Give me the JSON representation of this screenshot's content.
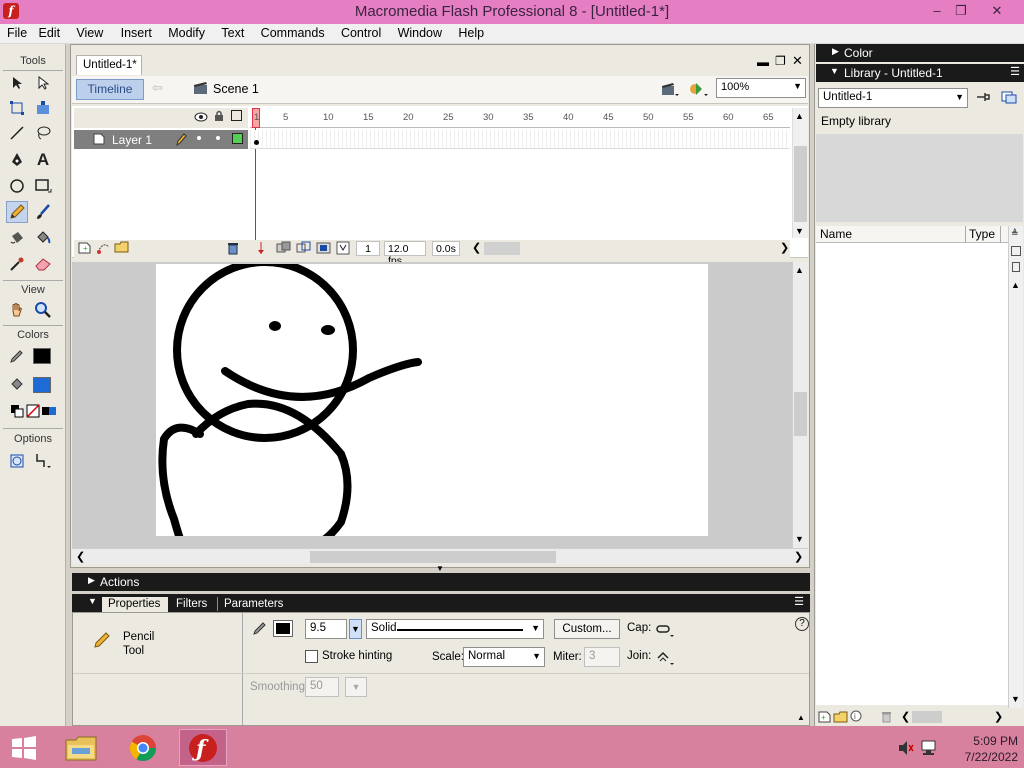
{
  "window": {
    "title": "Macromedia Flash Professional 8 - [Untitled-1*]",
    "app_icon": "flash-logo",
    "controls": [
      "–",
      "❐",
      "✕"
    ]
  },
  "menu": [
    "File",
    "Edit",
    "View",
    "Insert",
    "Modify",
    "Text",
    "Commands",
    "Control",
    "Window",
    "Help"
  ],
  "tools": {
    "title": "Tools",
    "view_title": "View",
    "colors_title": "Colors",
    "options_title": "Options",
    "selected": "pencil-tool",
    "stroke_color": "#000000",
    "fill_color": "#1f6bd6"
  },
  "document": {
    "tab": "Untitled-1*",
    "timeline_button": "Timeline",
    "scene": "Scene 1",
    "zoom": "100%"
  },
  "timeline": {
    "layer_name": "Layer 1",
    "ruler": [
      "1",
      "5",
      "10",
      "15",
      "20",
      "25",
      "30",
      "35",
      "40",
      "45",
      "50",
      "55",
      "60",
      "65"
    ],
    "current_frame": "1",
    "fps": "12.0 fps",
    "elapsed": "0.0s"
  },
  "panels": {
    "actions": "Actions",
    "tabs": [
      "Properties",
      "Filters",
      "Parameters"
    ]
  },
  "properties": {
    "tool_name_line1": "Pencil",
    "tool_name_line2": "Tool",
    "stroke_height": "9.5",
    "stroke_style": "Solid",
    "custom_button": "Custom...",
    "cap_label": "Cap:",
    "stroke_hinting": "Stroke hinting",
    "scale_label": "Scale:",
    "scale_value": "Normal",
    "miter_label": "Miter:",
    "miter_value": "3",
    "join_label": "Join:",
    "smoothing_label": "Smoothing",
    "smoothing_value": "50"
  },
  "right": {
    "color_panel": "Color",
    "library_panel": "Library - Untitled-1",
    "library_select": "Untitled-1",
    "empty_text": "Empty library",
    "col_name": "Name",
    "col_type": "Type"
  },
  "taskbar": {
    "time": "5:09 PM",
    "date": "7/22/2022"
  }
}
